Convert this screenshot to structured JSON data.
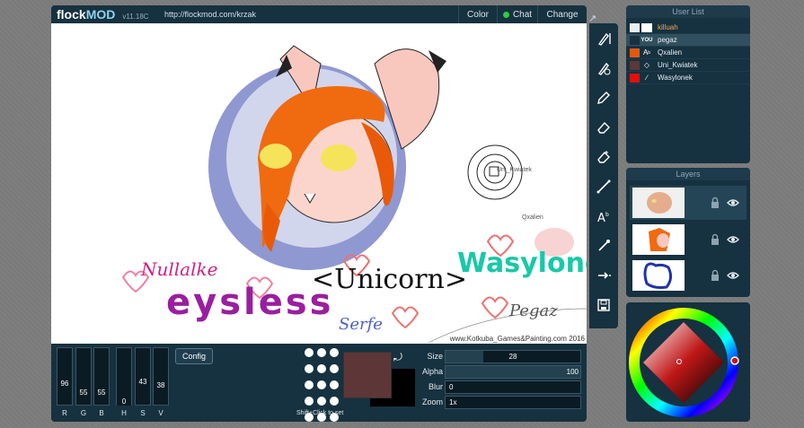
{
  "app": {
    "logo_part1": "flock",
    "logo_part2": "MOD",
    "version": "v11.18C",
    "url": "http://flockmod.com/krzak"
  },
  "topbar": {
    "color_label": "Color",
    "chat_label": "Chat",
    "change_label": "Change"
  },
  "canvas": {
    "watermark": "www.Kotkuba_Games&Painting.com 2016",
    "cursor_names": [
      "Uni_Kwiatek",
      "Qxalien"
    ],
    "texts": {
      "nullalke": "Nullalke",
      "eysless": "eysless",
      "unicorn": "<Unicorn>",
      "wasylonek": "Wasylonek",
      "serfe": "Serfe",
      "pegaz": "Pegaz"
    }
  },
  "user_list": {
    "title": "User List",
    "users": [
      {
        "name": "killuah",
        "color": "#e8eef2",
        "icon": "blank",
        "highlight": true
      },
      {
        "name": "pegaz",
        "color": "#16313f",
        "icon": "YOU",
        "selected": true
      },
      {
        "name": "Qxalien",
        "color": "#e05a12",
        "icon": "text-tool-icon"
      },
      {
        "name": "Uni_Kwiatek",
        "color": "#5d3737",
        "icon": "eraser-icon"
      },
      {
        "name": "Wasylonek",
        "color": "#e01010",
        "icon": "brush-icon"
      }
    ]
  },
  "layers": {
    "title": "Layers",
    "count": 3
  },
  "toolbar": {
    "tools": [
      "brush-tool-icon",
      "fill-brush-icon",
      "pencil-icon",
      "eraser-icon",
      "eraser-soft-icon",
      "line-tool-icon",
      "text-tool-icon",
      "color-picker-icon",
      "arrow-right-icon",
      "save-icon"
    ]
  },
  "color_sliders": [
    {
      "label": "R",
      "value": "96"
    },
    {
      "label": "G",
      "value": "55"
    },
    {
      "label": "B",
      "value": "55"
    },
    {
      "label": "H",
      "value": "0"
    },
    {
      "label": "S",
      "value": "43"
    },
    {
      "label": "V",
      "value": "38"
    }
  ],
  "bottom": {
    "config_label": "Config",
    "brush_hint": "Shift+Click to set",
    "primary_color": "#5d3737",
    "secondary_color": "#000000",
    "params": [
      {
        "label": "Size",
        "value": "28",
        "level": 0.28
      },
      {
        "label": "Alpha",
        "value": "100",
        "level": 1.0
      },
      {
        "label": "Blur",
        "value": "0",
        "level": 0.0
      },
      {
        "label": "Zoom",
        "value": "1x",
        "level": 0.0
      }
    ]
  }
}
